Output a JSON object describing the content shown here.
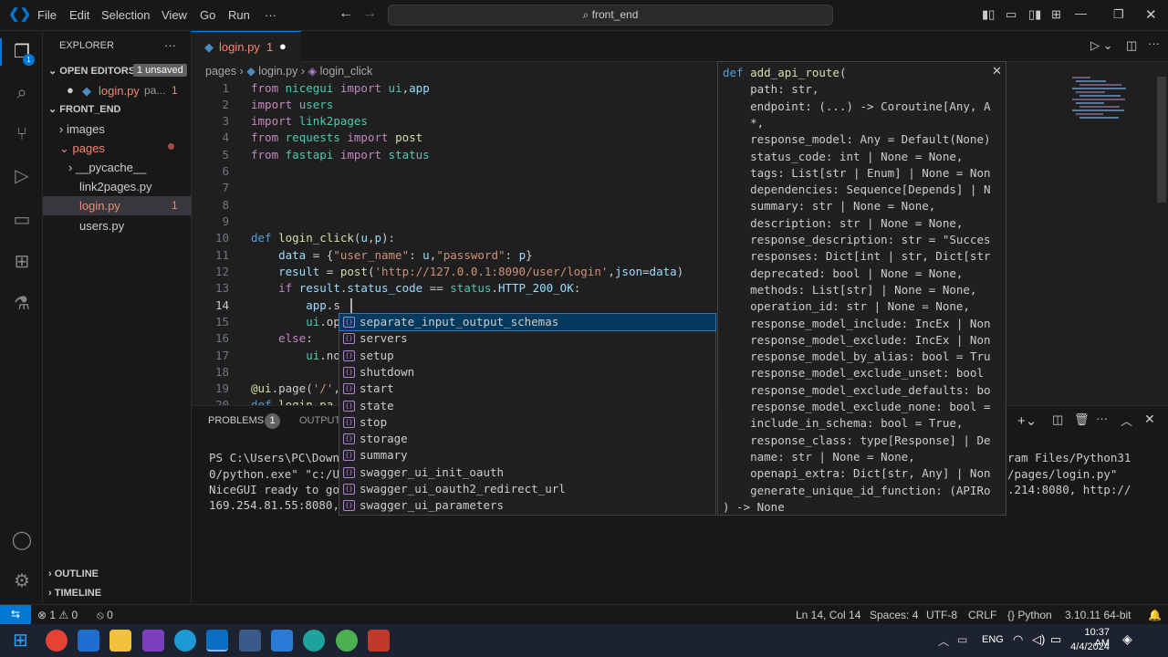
{
  "menu": {
    "file": "File",
    "edit": "Edit",
    "selection": "Selection",
    "view": "View",
    "go": "Go",
    "run": "Run",
    "more": "···"
  },
  "search": {
    "text": "front_end"
  },
  "sidebar": {
    "title": "EXPLORER",
    "more": "···",
    "open_editors": "OPEN EDITORS",
    "unsaved": "1 unsaved",
    "open_file": "login.py",
    "open_file_path": "pa...",
    "open_file_count": "1",
    "folder": "FRONT_END",
    "items": [
      {
        "label": "images"
      },
      {
        "label": "pages"
      },
      {
        "label": "__pycache__"
      },
      {
        "label": "link2pages.py"
      },
      {
        "label": "login.py",
        "badge": "1"
      },
      {
        "label": "users.py"
      }
    ],
    "outline": "OUTLINE",
    "timeline": "TIMELINE"
  },
  "tab": {
    "name": "login.py",
    "count": "1"
  },
  "breadcrumb": {
    "a": "pages",
    "b": "login.py",
    "c": "login_click"
  },
  "code": {
    "l1": [
      {
        "t": "from ",
        "c": "kw"
      },
      {
        "t": "nicegui ",
        "c": "mod"
      },
      {
        "t": "import ",
        "c": "kw"
      },
      {
        "t": "ui",
        "c": "mod"
      },
      {
        "t": ",",
        "c": ""
      },
      {
        "t": "app",
        "c": "var"
      }
    ],
    "l2": [
      {
        "t": "import ",
        "c": "kw"
      },
      {
        "t": "users",
        "c": "mod"
      }
    ],
    "l3": [
      {
        "t": "import ",
        "c": "kw"
      },
      {
        "t": "link2pages",
        "c": "mod"
      }
    ],
    "l4": [
      {
        "t": "from ",
        "c": "kw"
      },
      {
        "t": "requests ",
        "c": "mod"
      },
      {
        "t": "import ",
        "c": "kw"
      },
      {
        "t": "post",
        "c": "fn"
      }
    ],
    "l5": [
      {
        "t": "from ",
        "c": "kw"
      },
      {
        "t": "fastapi ",
        "c": "mod"
      },
      {
        "t": "import ",
        "c": "kw"
      },
      {
        "t": "status",
        "c": "mod"
      }
    ],
    "l10": [
      {
        "t": "def ",
        "c": "kb"
      },
      {
        "t": "login_click",
        "c": "fn"
      },
      {
        "t": "(",
        "c": ""
      },
      {
        "t": "u",
        "c": "var"
      },
      {
        "t": ",",
        "c": ""
      },
      {
        "t": "p",
        "c": "var"
      },
      {
        "t": "):",
        "c": ""
      }
    ],
    "l11": [
      {
        "t": "    data ",
        "c": "var"
      },
      {
        "t": "= {",
        "c": ""
      },
      {
        "t": "\"user_name\"",
        "c": "st"
      },
      {
        "t": ": ",
        "c": ""
      },
      {
        "t": "u",
        "c": "var"
      },
      {
        "t": ",",
        "c": ""
      },
      {
        "t": "\"password\"",
        "c": "st"
      },
      {
        "t": ": ",
        "c": ""
      },
      {
        "t": "p",
        "c": "var"
      },
      {
        "t": "}",
        "c": ""
      }
    ],
    "l12": [
      {
        "t": "    result ",
        "c": "var"
      },
      {
        "t": "= ",
        "c": ""
      },
      {
        "t": "post",
        "c": "fn"
      },
      {
        "t": "(",
        "c": ""
      },
      {
        "t": "'http://127.0.0.1:8090/user/login'",
        "c": "st"
      },
      {
        "t": ",",
        "c": ""
      },
      {
        "t": "json",
        "c": "var"
      },
      {
        "t": "=",
        "c": ""
      },
      {
        "t": "data",
        "c": "var"
      },
      {
        "t": ")",
        "c": ""
      }
    ],
    "l13": [
      {
        "t": "    if ",
        "c": "kw"
      },
      {
        "t": "result",
        "c": "var"
      },
      {
        "t": ".",
        "c": ""
      },
      {
        "t": "status_code ",
        "c": "var"
      },
      {
        "t": "== ",
        "c": ""
      },
      {
        "t": "status",
        "c": "mod"
      },
      {
        "t": ".",
        "c": ""
      },
      {
        "t": "HTTP_200_OK",
        "c": "var"
      },
      {
        "t": ":",
        "c": ""
      }
    ],
    "l14": [
      {
        "t": "        app",
        "c": "var"
      },
      {
        "t": ".s",
        "c": ""
      }
    ],
    "l15": [
      {
        "t": "        ui",
        "c": "mod"
      },
      {
        "t": ".op",
        "c": ""
      }
    ],
    "l16": [
      {
        "t": "    else",
        "c": "kw"
      },
      {
        "t": ":",
        "c": ""
      }
    ],
    "l17": [
      {
        "t": "        ui",
        "c": "mod"
      },
      {
        "t": ".no",
        "c": ""
      }
    ],
    "l19": [
      {
        "t": "@ui",
        "c": "fn"
      },
      {
        "t": ".page(",
        "c": ""
      },
      {
        "t": "'/'",
        "c": "st"
      },
      {
        "t": ",",
        "c": ""
      }
    ],
    "l20": [
      {
        "t": "def ",
        "c": "kb"
      },
      {
        "t": "login_pa",
        "c": "fn"
      }
    ]
  },
  "line_numbers": [
    "1",
    "2",
    "3",
    "4",
    "5",
    "6",
    "7",
    "8",
    "9",
    "10",
    "11",
    "12",
    "13",
    "14",
    "15",
    "16",
    "17",
    "18",
    "19",
    "20"
  ],
  "suggestions": [
    "separate_input_output_schemas",
    "servers",
    "setup",
    "shutdown",
    "start",
    "state",
    "stop",
    "storage",
    "summary",
    "swagger_ui_init_oauth",
    "swagger_ui_oauth2_redirect_url",
    "swagger_ui_parameters"
  ],
  "hover_lines": [
    "def add_api_route(",
    "    path: str,",
    "    endpoint: (...) -> Coroutine[Any, A",
    "    *,",
    "    response_model: Any = Default(None)",
    "    status_code: int | None = None,",
    "    tags: List[str | Enum] | None = Non",
    "    dependencies: Sequence[Depends] | N",
    "    summary: str | None = None,",
    "    description: str | None = None,",
    "    response_description: str = \"Succes",
    "    responses: Dict[int | str, Dict[str",
    "    deprecated: bool | None = None,",
    "    methods: List[str] | None = None,",
    "    operation_id: str | None = None,",
    "    response_model_include: IncEx | Non",
    "    response_model_exclude: IncEx | Non",
    "    response_model_by_alias: bool = Tru",
    "    response_model_exclude_unset: bool",
    "    response_model_exclude_defaults: bo",
    "    response_model_exclude_none: bool =",
    "    include_in_schema: bool = True,",
    "    response_class: type[Response] | De",
    "    name: str | None = None,",
    "    openapi_extra: Dict[str, Any] | Non",
    "    generate_unique_id_function: (APIRo",
    ") -> None"
  ],
  "panel": {
    "problems": "PROBLEMS",
    "problems_count": "1",
    "output": "OUTPUT",
    "term_left": [
      "PS C:\\Users\\PC\\Downl",
      "0/python.exe\" \"c:/Us",
      "NiceGUI ready to go",
      "169.254.81.55:8080,"
    ],
    "term_right": [
      "ram Files/Python31",
      "/pages/login.py\"",
      ".214:8080, http://"
    ]
  },
  "status": {
    "errors": "1",
    "warnings": "0",
    "ports": "0",
    "pos": "Ln 14, Col 14",
    "spaces": "Spaces: 4",
    "enc": "UTF-8",
    "eol": "CRLF",
    "lang": "Python",
    "ver": "3.10.11 64-bit"
  },
  "taskbar": {
    "lang": "ENG",
    "time": "10:37 AM",
    "date": "4/4/2024"
  },
  "colors": {
    "accent": "#0078d4",
    "selection": "#04395e"
  }
}
